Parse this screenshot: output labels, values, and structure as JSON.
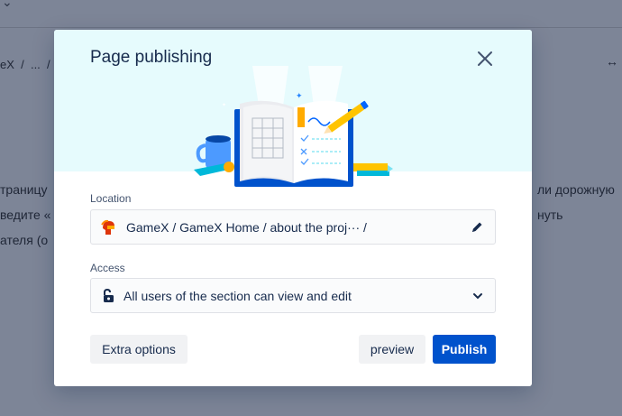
{
  "background": {
    "breadcrumb": "eX  /  ...  /",
    "arrows": "↔",
    "lines_left": [
      "траницу",
      "ведите «",
      "ателя (о"
    ],
    "lines_right": [
      "ли дорожную",
      "нуть"
    ]
  },
  "modal": {
    "title": "Page publishing",
    "location": {
      "label": "Location",
      "path": "GameX / GameX Home / about the proj··· /"
    },
    "access": {
      "label": "Access",
      "value": "All users of the section can view and edit"
    },
    "buttons": {
      "extra": "Extra options",
      "preview": "preview",
      "publish": "Publish"
    }
  },
  "colors": {
    "primary": "#0052cc",
    "hero_bg": "#e6fbfd",
    "text": "#172b4d"
  }
}
